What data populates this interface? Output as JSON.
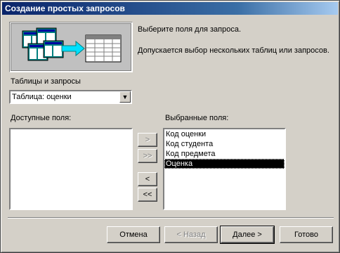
{
  "window": {
    "title": "Создание простых запросов"
  },
  "info": {
    "line1": "Выберите поля для запроса.",
    "line2": "Допускается выбор нескольких таблиц или запросов."
  },
  "source": {
    "label": "Таблицы и запросы",
    "selected": "Таблица: оценки"
  },
  "available": {
    "label": "Доступные поля:",
    "items": []
  },
  "selected_fields": {
    "label": "Выбранные поля:",
    "items": [
      "Код оценки",
      "Код студента",
      "Код предмета",
      "Оценка"
    ],
    "highlighted": "Оценка"
  },
  "move_buttons": {
    "add": ">",
    "add_all": ">>",
    "remove": "<",
    "remove_all": "<<"
  },
  "footer": {
    "cancel": "Отмена",
    "back": "< Назад",
    "next": "Далее >",
    "finish": "Готово"
  }
}
